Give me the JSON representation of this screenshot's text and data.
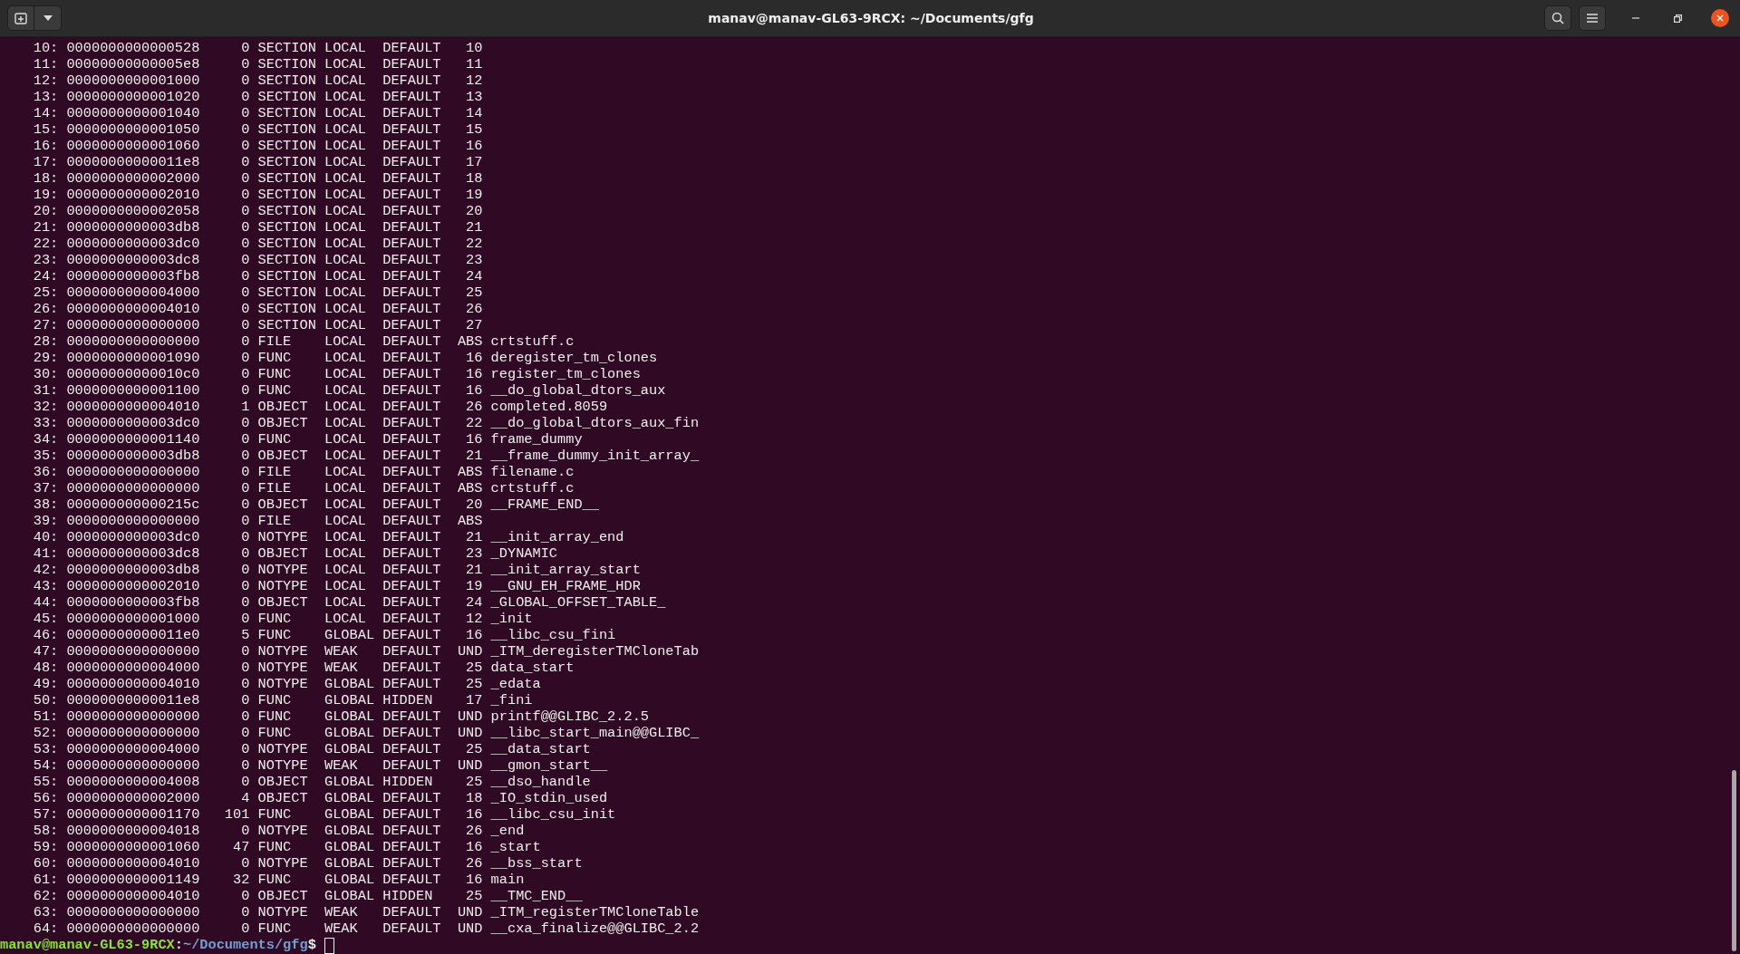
{
  "window": {
    "title": "manav@manav-GL63-9RCX: ~/Documents/gfg"
  },
  "lines": [
    "    10: 0000000000000528     0 SECTION LOCAL  DEFAULT   10",
    "    11: 00000000000005e8     0 SECTION LOCAL  DEFAULT   11",
    "    12: 0000000000001000     0 SECTION LOCAL  DEFAULT   12",
    "    13: 0000000000001020     0 SECTION LOCAL  DEFAULT   13",
    "    14: 0000000000001040     0 SECTION LOCAL  DEFAULT   14",
    "    15: 0000000000001050     0 SECTION LOCAL  DEFAULT   15",
    "    16: 0000000000001060     0 SECTION LOCAL  DEFAULT   16",
    "    17: 00000000000011e8     0 SECTION LOCAL  DEFAULT   17",
    "    18: 0000000000002000     0 SECTION LOCAL  DEFAULT   18",
    "    19: 0000000000002010     0 SECTION LOCAL  DEFAULT   19",
    "    20: 0000000000002058     0 SECTION LOCAL  DEFAULT   20",
    "    21: 0000000000003db8     0 SECTION LOCAL  DEFAULT   21",
    "    22: 0000000000003dc0     0 SECTION LOCAL  DEFAULT   22",
    "    23: 0000000000003dc8     0 SECTION LOCAL  DEFAULT   23",
    "    24: 0000000000003fb8     0 SECTION LOCAL  DEFAULT   24",
    "    25: 0000000000004000     0 SECTION LOCAL  DEFAULT   25",
    "    26: 0000000000004010     0 SECTION LOCAL  DEFAULT   26",
    "    27: 0000000000000000     0 SECTION LOCAL  DEFAULT   27",
    "    28: 0000000000000000     0 FILE    LOCAL  DEFAULT  ABS crtstuff.c",
    "    29: 0000000000001090     0 FUNC    LOCAL  DEFAULT   16 deregister_tm_clones",
    "    30: 00000000000010c0     0 FUNC    LOCAL  DEFAULT   16 register_tm_clones",
    "    31: 0000000000001100     0 FUNC    LOCAL  DEFAULT   16 __do_global_dtors_aux",
    "    32: 0000000000004010     1 OBJECT  LOCAL  DEFAULT   26 completed.8059",
    "    33: 0000000000003dc0     0 OBJECT  LOCAL  DEFAULT   22 __do_global_dtors_aux_fin",
    "    34: 0000000000001140     0 FUNC    LOCAL  DEFAULT   16 frame_dummy",
    "    35: 0000000000003db8     0 OBJECT  LOCAL  DEFAULT   21 __frame_dummy_init_array_",
    "    36: 0000000000000000     0 FILE    LOCAL  DEFAULT  ABS filename.c",
    "    37: 0000000000000000     0 FILE    LOCAL  DEFAULT  ABS crtstuff.c",
    "    38: 000000000000215c     0 OBJECT  LOCAL  DEFAULT   20 __FRAME_END__",
    "    39: 0000000000000000     0 FILE    LOCAL  DEFAULT  ABS",
    "    40: 0000000000003dc0     0 NOTYPE  LOCAL  DEFAULT   21 __init_array_end",
    "    41: 0000000000003dc8     0 OBJECT  LOCAL  DEFAULT   23 _DYNAMIC",
    "    42: 0000000000003db8     0 NOTYPE  LOCAL  DEFAULT   21 __init_array_start",
    "    43: 0000000000002010     0 NOTYPE  LOCAL  DEFAULT   19 __GNU_EH_FRAME_HDR",
    "    44: 0000000000003fb8     0 OBJECT  LOCAL  DEFAULT   24 _GLOBAL_OFFSET_TABLE_",
    "    45: 0000000000001000     0 FUNC    LOCAL  DEFAULT   12 _init",
    "    46: 00000000000011e0     5 FUNC    GLOBAL DEFAULT   16 __libc_csu_fini",
    "    47: 0000000000000000     0 NOTYPE  WEAK   DEFAULT  UND _ITM_deregisterTMCloneTab",
    "    48: 0000000000004000     0 NOTYPE  WEAK   DEFAULT   25 data_start",
    "    49: 0000000000004010     0 NOTYPE  GLOBAL DEFAULT   25 _edata",
    "    50: 00000000000011e8     0 FUNC    GLOBAL HIDDEN    17 _fini",
    "    51: 0000000000000000     0 FUNC    GLOBAL DEFAULT  UND printf@@GLIBC_2.2.5",
    "    52: 0000000000000000     0 FUNC    GLOBAL DEFAULT  UND __libc_start_main@@GLIBC_",
    "    53: 0000000000004000     0 NOTYPE  GLOBAL DEFAULT   25 __data_start",
    "    54: 0000000000000000     0 NOTYPE  WEAK   DEFAULT  UND __gmon_start__",
    "    55: 0000000000004008     0 OBJECT  GLOBAL HIDDEN    25 __dso_handle",
    "    56: 0000000000002000     4 OBJECT  GLOBAL DEFAULT   18 _IO_stdin_used",
    "    57: 0000000000001170   101 FUNC    GLOBAL DEFAULT   16 __libc_csu_init",
    "    58: 0000000000004018     0 NOTYPE  GLOBAL DEFAULT   26 _end",
    "    59: 0000000000001060    47 FUNC    GLOBAL DEFAULT   16 _start",
    "    60: 0000000000004010     0 NOTYPE  GLOBAL DEFAULT   26 __bss_start",
    "    61: 0000000000001149    32 FUNC    GLOBAL DEFAULT   16 main",
    "    62: 0000000000004010     0 OBJECT  GLOBAL HIDDEN    25 __TMC_END__",
    "    63: 0000000000000000     0 NOTYPE  WEAK   DEFAULT  UND _ITM_registerTMCloneTable",
    "    64: 0000000000000000     0 FUNC    WEAK   DEFAULT  UND __cxa_finalize@@GLIBC_2.2"
  ],
  "prompt": {
    "user_host": "manav@manav-GL63-9RCX",
    "separator": ":",
    "path": "~/Documents/gfg",
    "symbol": "$"
  }
}
